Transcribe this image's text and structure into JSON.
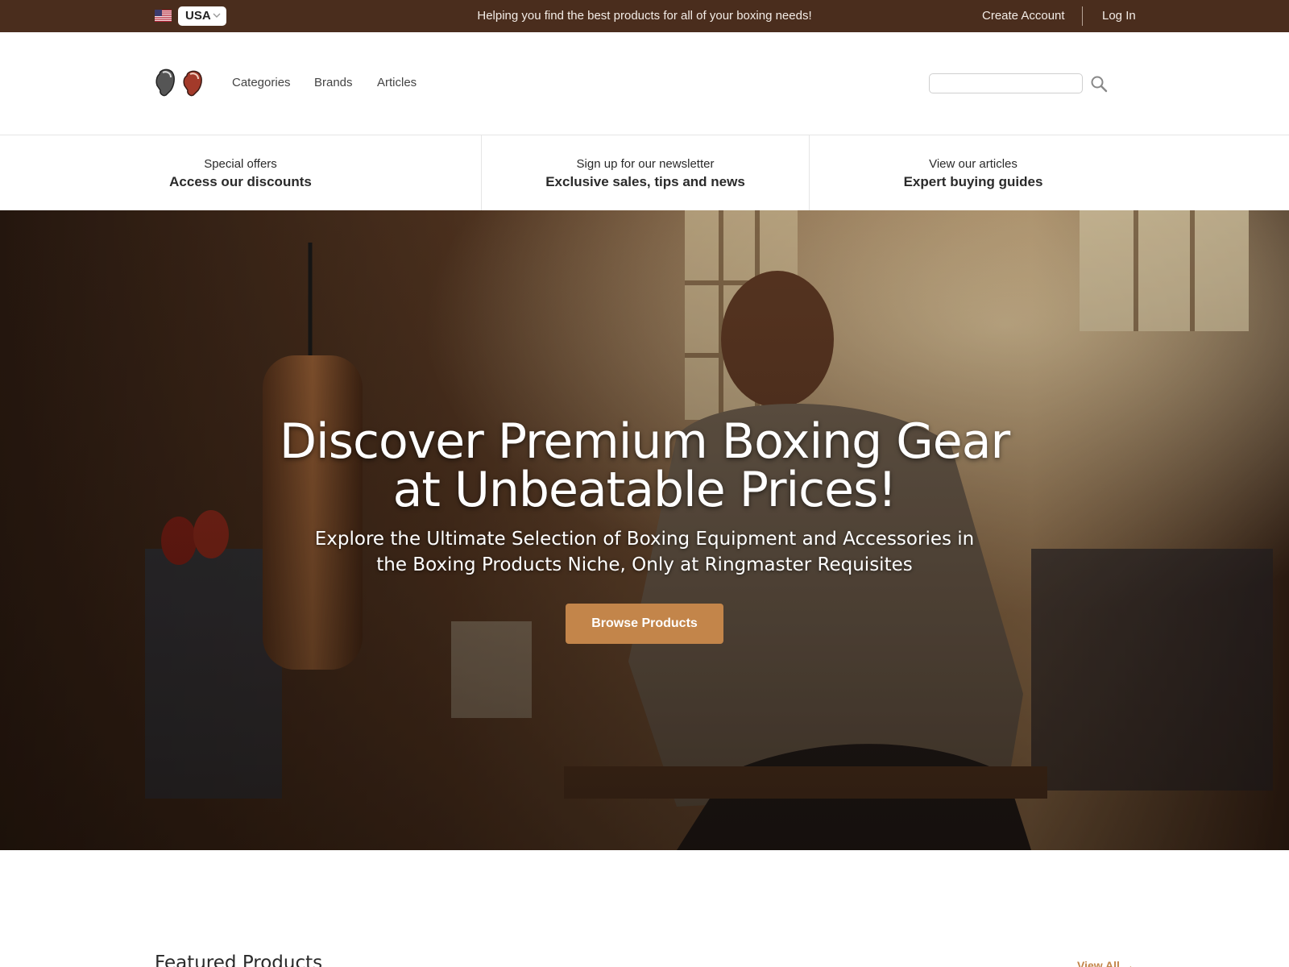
{
  "topbar": {
    "country": "USA",
    "tagline": "Helping you find the best products for all of your boxing needs!",
    "create_account": "Create Account",
    "login": "Log In"
  },
  "header": {
    "nav": [
      "Categories",
      "Brands",
      "Articles"
    ],
    "search_placeholder": ""
  },
  "features": [
    {
      "small": "Special offers",
      "big": "Access our discounts"
    },
    {
      "small": "Sign up for our newsletter",
      "big": "Exclusive sales, tips and news"
    },
    {
      "small": "View our articles",
      "big": "Expert buying guides"
    }
  ],
  "hero": {
    "title_line1": "Discover Premium Boxing Gear",
    "title_line2": "at Unbeatable Prices!",
    "subtitle_line1": "Explore the Ultimate Selection of Boxing Equipment and Accessories in",
    "subtitle_line2": "the Boxing Products Niche, Only at Ringmaster Requisites",
    "cta": "Browse Products"
  },
  "featured": {
    "title": "Featured Products",
    "view_all": "View All →"
  },
  "colors": {
    "topbar_bg": "#4a2d1d",
    "accent": "#c3854a"
  },
  "icons": [
    "us-flag-icon",
    "chevron-down-icon",
    "boxing-gloves-logo",
    "search-icon"
  ]
}
